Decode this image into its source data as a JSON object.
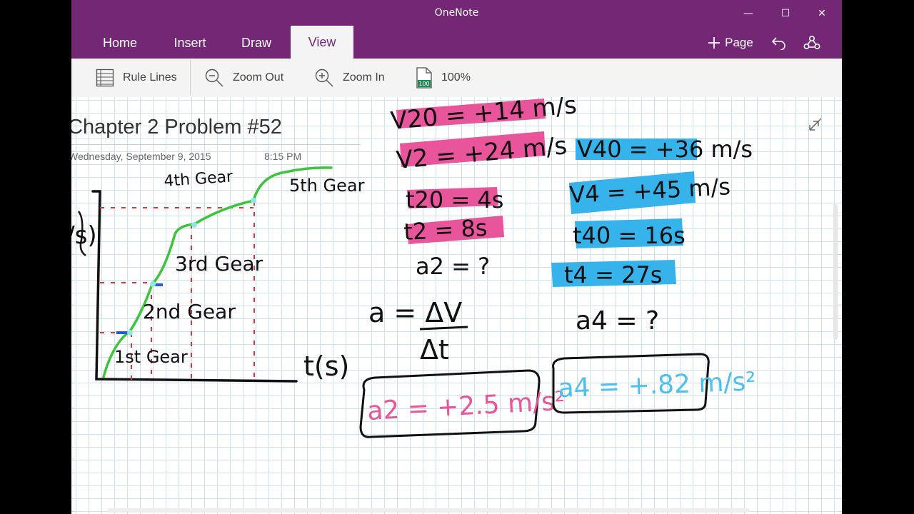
{
  "window": {
    "app_title": "OneNote",
    "minimize_glyph": "—",
    "maximize_glyph": "☐",
    "close_glyph": "✕"
  },
  "tabs": [
    {
      "label": "Home"
    },
    {
      "label": "Insert"
    },
    {
      "label": "Draw"
    },
    {
      "label": "View",
      "active": true
    }
  ],
  "header_actions": {
    "add_page_label": "Page",
    "undo_icon": "undo-icon",
    "share_icon": "share-icon"
  },
  "toolbar": {
    "rule_lines_label": "Rule Lines",
    "zoom_out_label": "Zoom Out",
    "zoom_in_label": "Zoom In",
    "zoom_level": "100%",
    "zoom_badge": "100"
  },
  "page": {
    "title": "Chapter 2 Problem #52",
    "date": "Wednesday, September 9, 2015",
    "time": "8:15 PM"
  },
  "ink": {
    "gear_4": "4th Gear",
    "gear_5": "5th Gear",
    "gear_3": "3rd Gear",
    "gear_2": "2nd Gear",
    "gear_1": "1st Gear",
    "t_axis": "t(s)",
    "v_axis": "V/s)",
    "v20": "V20 = +14 m/s",
    "v2": "V2 = +24 m/s",
    "t20": "t20 = 4s",
    "t2": "t2 = 8s",
    "a2q": "a2 = ?",
    "a_formula_num": "a = ΔV",
    "a_formula_den": "Δt",
    "a2_answer": "a2 = +2.5 m/s²",
    "v40": "V40 = +36 m/s",
    "v4": "V4 = +45 m/s",
    "t40": "t40 = 16s",
    "t4": "t4 = 27s",
    "a4q": "a4 = ?",
    "a4_answer": "a4 = +.82 m/s²"
  },
  "colors": {
    "titlebar": "#742774",
    "pink_highlight": "#e8559a",
    "blue_highlight": "#35b3ea",
    "graph_curve": "#3cc43c",
    "answer_pink": "#e8559a",
    "answer_blue": "#4fc0ee"
  }
}
